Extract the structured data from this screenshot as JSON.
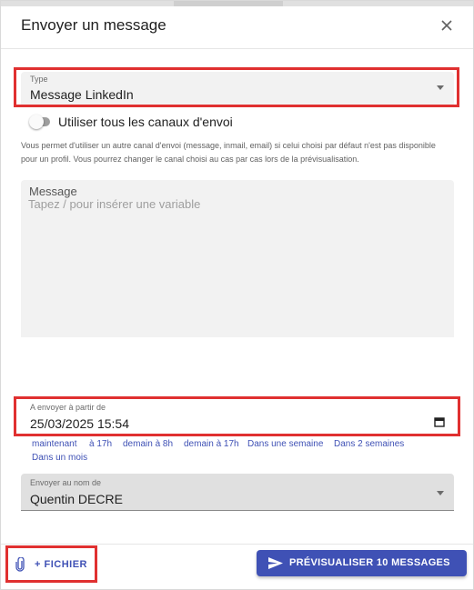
{
  "dialog": {
    "title": "Envoyer un message"
  },
  "type_field": {
    "label": "Type",
    "value": "Message LinkedIn"
  },
  "all_channels": {
    "label": "Utiliser tous les canaux d'envoi",
    "enabled": false,
    "help": "Vous permet d'utiliser un autre canal d'envoi (message, inmail, email) si celui choisi par défaut n'est pas disponible pour un profil. Vous pourrez changer le canal choisi au cas par cas lors de la prévisualisation."
  },
  "message_field": {
    "label": "Message",
    "placeholder": "Tapez / pour insérer une variable",
    "value": ""
  },
  "send_from": {
    "label": "A envoyer à partir de",
    "value": "25/03/2025 15:54",
    "quick_options": [
      "maintenant",
      "à 17h",
      "demain à 8h",
      "demain à 17h",
      "Dans une semaine",
      "Dans 2 semaines",
      "Dans un mois"
    ]
  },
  "sender_field": {
    "label": "Envoyer au nom de",
    "value": "Quentin DECRE"
  },
  "footer": {
    "file_label": "+ FICHIER",
    "preview_label": "PRÉVISUALISER 10 MESSAGES"
  },
  "icons": [
    "close-icon",
    "dropdown-arrow-icon",
    "calendar-icon",
    "paperclip-icon",
    "send-icon"
  ],
  "colors": {
    "accent": "#3f51b5",
    "highlight_box": "#e03030",
    "field_bg": "#f2f2f2"
  }
}
